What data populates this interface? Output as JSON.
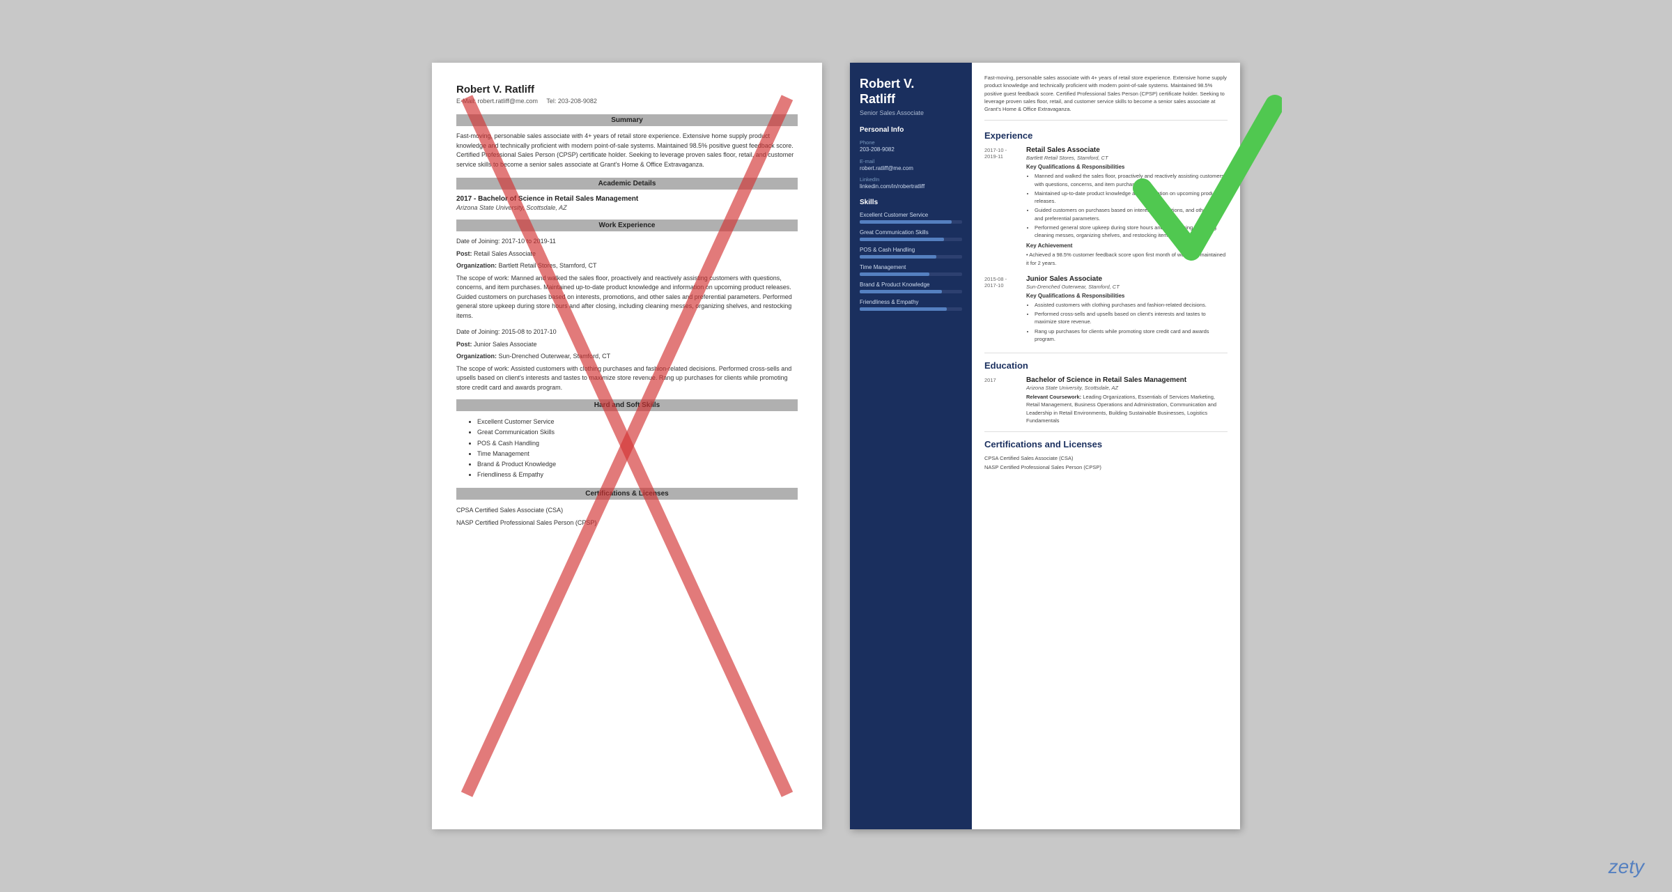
{
  "page": {
    "background_color": "#c8c8c8",
    "brand": "zety"
  },
  "left_resume": {
    "name": "Robert V. Ratliff",
    "contact_email": "E-Mail: robert.ratliff@me.com",
    "contact_tel": "Tel: 203-208-9082",
    "sections": {
      "summary_header": "Summary",
      "summary_text": "Fast-moving, personable sales associate with 4+ years of retail store experience. Extensive home supply product knowledge and technically proficient with modern point-of-sale systems. Maintained 98.5% positive guest feedback score. Certified Professional Sales Person (CPSP) certificate holder. Seeking to leverage proven sales floor, retail, and customer service skills to become a senior sales associate at Grant's Home & Office Extravaganza.",
      "academic_header": "Academic Details",
      "degree": "2017 - Bachelor of Science in Retail Sales Management",
      "school": "Arizona State University, Scottsdale, AZ",
      "work_header": "Work Experience",
      "job1_date": "Date of Joining: 2017-10 to 2019-11",
      "job1_post": "Post: Retail Sales Associate",
      "job1_org": "Organization: Bartlett Retail Stores, Stamford, CT",
      "job1_scope_label": "The scope of work:",
      "job1_scope": "Manned and walked the sales floor, proactively and reactively assisting customers with questions, concerns, and item purchases. Maintained up-to-date product knowledge and information on upcoming product releases. Guided customers on purchases based on interests, promotions, and other sales and preferential parameters. Performed general store upkeep during store hours and after closing, including cleaning messes, organizing shelves, and restocking items.",
      "job2_date": "Date of Joining: 2015-08 to 2017-10",
      "job2_post": "Post: Junior Sales Associate",
      "job2_org": "Organization: Sun-Drenched Outerwear, Stamford, CT",
      "job2_scope_label": "The scope of work:",
      "job2_scope": "Assisted customers with clothing purchases and fashion-related decisions. Performed cross-sells and upsells based on client's interests and tastes to maximize store revenue. Rang up purchases for clients while promoting store credit card and awards program.",
      "skills_header": "Hard and Soft Skills",
      "skills": [
        "Excellent Customer Service",
        "Great Communication Skills",
        "POS & Cash Handling",
        "Time Management",
        "Brand & Product Knowledge",
        "Friendliness & Empathy"
      ],
      "certs_header": "Certifications & Licenses",
      "cert1": "CPSA Certified Sales Associate (CSA)",
      "cert2": "NASP Certified Professional Sales Person (CPSP)"
    }
  },
  "right_resume": {
    "name_line1": "Robert V.",
    "name_line2": "Ratliff",
    "title": "Senior Sales Associate",
    "personal_info": {
      "section_label": "Personal Info",
      "phone_label": "Phone",
      "phone": "203-208-9082",
      "email_label": "E-mail",
      "email": "robert.ratliff@me.com",
      "linkedin_label": "LinkedIn",
      "linkedin": "linkedin.com/in/robertratliff"
    },
    "skills_section": {
      "label": "Skills",
      "items": [
        {
          "name": "Excellent Customer Service",
          "pct": 90
        },
        {
          "name": "Great Communication Skills",
          "pct": 82
        },
        {
          "name": "POS & Cash Handling",
          "pct": 75
        },
        {
          "name": "Time Management",
          "pct": 68
        },
        {
          "name": "Brand & Product Knowledge",
          "pct": 80
        },
        {
          "name": "Friendliness & Empathy",
          "pct": 85
        }
      ]
    },
    "summary_text": "Fast-moving, personable sales associate with 4+ years of retail store experience. Extensive home supply product knowledge and technically proficient with modern point-of-sale systems. Maintained 98.5% positive guest feedback score. Certified Professional Sales Person (CPSP) certificate holder. Seeking to leverage proven sales floor, retail, and customer service skills to become a senior sales associate at Grant's Home & Office Extravaganza.",
    "experience": {
      "section_title": "Experience",
      "jobs": [
        {
          "date": "2017-10 - 2019-11",
          "title": "Retail Sales Associate",
          "org": "Bartlett Retail Stores, Stamford, CT",
          "kq_label": "Key Qualifications & Responsibilities",
          "bullets": [
            "Manned and walked the sales floor, proactively and reactively assisting customers with questions, concerns, and item purchases.",
            "Maintained up-to-date product knowledge and information on upcoming product releases.",
            "Guided customers on purchases based on interests, promotions, and other sales and preferential parameters.",
            "Performed general store upkeep during store hours and after closing, including cleaning messes, organizing shelves, and restocking items."
          ],
          "achievement_label": "Key Achievement",
          "achievement": "Achieved a 98.5% customer feedback score upon first month of work and maintained it for 2 years."
        },
        {
          "date": "2015-08 - 2017-10",
          "title": "Junior Sales Associate",
          "org": "Sun-Drenched Outerwear, Stamford, CT",
          "kq_label": "Key Qualifications & Responsibilities",
          "bullets": [
            "Assisted customers with clothing purchases and fashion-related decisions.",
            "Performed cross-sells and upsells based on client's interests and tastes to maximize store revenue.",
            "Rang up purchases for clients while promoting store credit card and awards program."
          ]
        }
      ]
    },
    "education": {
      "section_title": "Education",
      "entries": [
        {
          "year": "2017",
          "degree": "Bachelor of Science in Retail Sales Management",
          "school": "Arizona State University, Scottsdale, AZ",
          "coursework_label": "Relevant Coursework:",
          "coursework": "Leading Organizations, Essentials of Services Marketing, Retail Management, Business Operations and Administration, Communication and Leadership in Retail Environments, Building Sustainable Businesses, Logistics Fundamentals"
        }
      ]
    },
    "certifications": {
      "section_title": "Certifications and Licenses",
      "items": [
        "CPSA Certified Sales Associate (CSA)",
        "NASP Certified Professional Sales Person (CPSP)"
      ]
    }
  }
}
